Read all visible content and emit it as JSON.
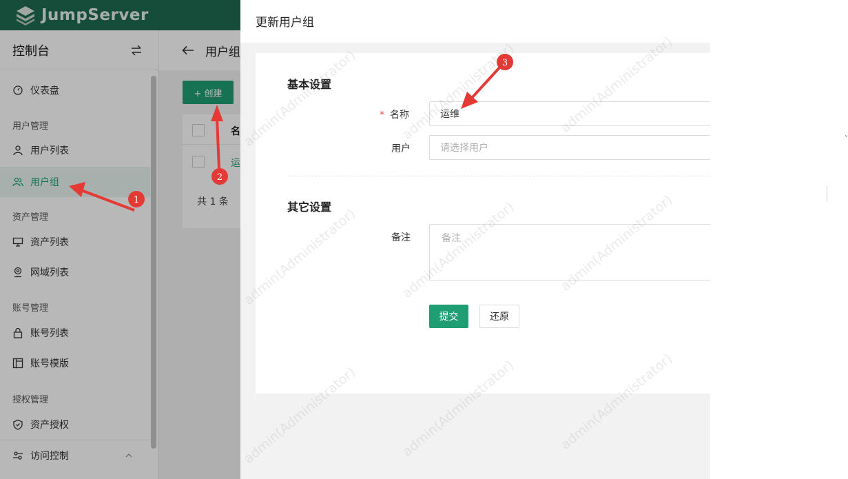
{
  "header": {
    "logo_text": "JumpServer"
  },
  "sidebar": {
    "title": "控制台",
    "items": {
      "dashboard": "仪表盘",
      "group_user_mgmt": "用户管理",
      "user_list": "用户列表",
      "user_group": "用户组",
      "group_asset_mgmt": "资产管理",
      "asset_list": "资产列表",
      "domain_list": "网域列表",
      "group_account_mgmt": "账号管理",
      "account_list": "账号列表",
      "account_template": "账号模版",
      "group_perm_mgmt": "授权管理",
      "asset_perm": "资产授权",
      "access_control": "访问控制"
    }
  },
  "main": {
    "title": "用户组",
    "create_label": "+ 创建",
    "table_header_name": "名",
    "row_name": "运",
    "total": "共 1 条"
  },
  "drawer": {
    "title": "更新用户组",
    "basic_section": "基本设置",
    "name_label": "名称",
    "required_mark": "*",
    "name_value": "运维",
    "users_label": "用户",
    "users_placeholder": "请选择用户",
    "other_section": "其它设置",
    "comment_label": "备注",
    "comment_placeholder": "备注",
    "submit_label": "提交",
    "reset_label": "还原"
  },
  "annotations": {
    "badge1": "1",
    "badge2": "2",
    "badge3": "3"
  },
  "watermark": "admin(Administrator)",
  "colors": {
    "brand_header": "#1f6b51",
    "primary": "#1f9e74",
    "annotation": "#e53935"
  }
}
